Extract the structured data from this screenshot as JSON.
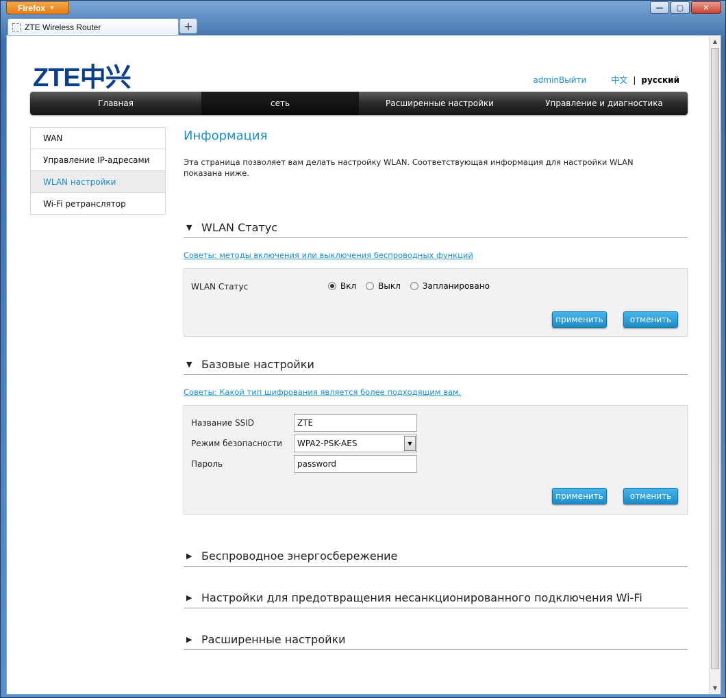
{
  "browser": {
    "menu_button": "Firefox",
    "tab_title": "ZTE Wireless Router",
    "new_tab": "+"
  },
  "header": {
    "logo": "ZTE中兴",
    "admin_logout": "adminВыйти",
    "lang_zh": "中文",
    "lang_sep": "|",
    "lang_ru": "русский"
  },
  "nav": {
    "items": [
      {
        "label": "Главная"
      },
      {
        "label": "сеть"
      },
      {
        "label": "Расширенные настройки"
      },
      {
        "label": "Управление и диагностика"
      }
    ],
    "active_index": 1
  },
  "sidebar": {
    "items": [
      {
        "label": "WAN"
      },
      {
        "label": "Управление IP-адресами"
      },
      {
        "label": "WLAN настройки"
      },
      {
        "label": "Wi-Fi ретранслятор"
      }
    ],
    "active_index": 2
  },
  "main": {
    "title": "Информация",
    "description": "Эта страница позволяет вам делать настройку WLAN. Соответствующая информация для настройки WLAN показана ниже.",
    "wlan_status": {
      "heading": "WLAN Статус",
      "tip": "Советы: методы включения или выключения беспроводных функций",
      "label": "WLAN Статус",
      "options": [
        "Вкл",
        "Выкл",
        "Запланировано"
      ],
      "selected": "Вкл",
      "apply": "применить",
      "cancel": "отменить"
    },
    "basic": {
      "heading": "Базовые настройки",
      "tip": "Советы: Какой тип шифрования является более подходящим вам.",
      "ssid_label": "Название SSID",
      "ssid_value": "ZTE",
      "security_label": "Режим безопасности",
      "security_value": "WPA2-PSK-AES",
      "password_label": "Пароль",
      "password_value": "password",
      "apply": "применить",
      "cancel": "отменить"
    },
    "collapsed_sections": [
      {
        "heading": "Беспроводное энергосбережение"
      },
      {
        "heading": "Настройки для предотвращения несанкционированного подключения Wi-Fi"
      },
      {
        "heading": "Расширенные настройки"
      }
    ]
  },
  "icons": {
    "expanded": "triangle-down-icon",
    "collapsed": "triangle-right-icon"
  },
  "colors": {
    "accent": "#1a8fc8",
    "logo": "#0b3f8c",
    "nav_bg": "#2a2a2a"
  }
}
